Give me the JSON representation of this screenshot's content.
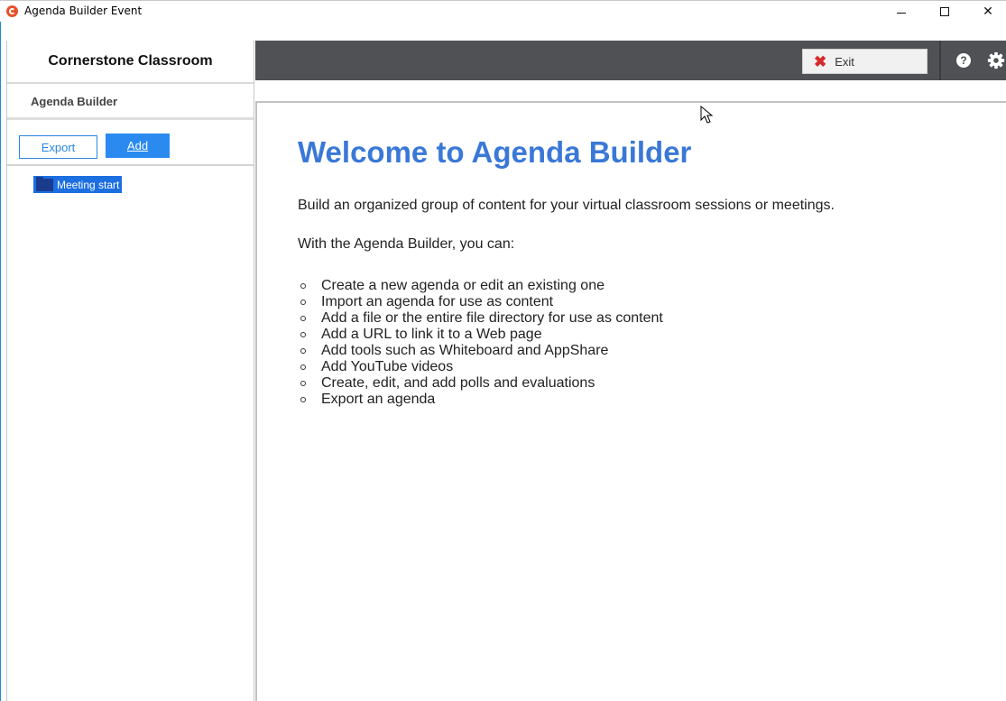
{
  "window": {
    "title": "Agenda Builder Event",
    "minimize": "–",
    "maximize": "□",
    "close": "✕"
  },
  "sidebar": {
    "brand": "Cornerstone Classroom",
    "section_title": "Agenda Builder",
    "export_label": "Export",
    "add_label": "Add",
    "tree": [
      {
        "label": "Meeting start",
        "icon": "folder-icon",
        "selected": true
      }
    ]
  },
  "toolbar": {
    "exit_label": "Exit",
    "help_icon": "help-icon",
    "settings_icon": "gear-icon"
  },
  "content": {
    "heading": "Welcome to Agenda Builder",
    "intro": "Build an organized group of content for your virtual classroom sessions or meetings.",
    "lead": "With the Agenda Builder, you can:",
    "features": [
      "Create a new agenda or edit an existing one",
      "Import an agenda for use as content",
      "Add a file or the entire file directory for use as content",
      "Add a URL to link it to a Web page",
      "Add tools such as Whiteboard and AppShare",
      "Add YouTube videos",
      "Create, edit, and add polls and evaluations",
      "Export an agenda"
    ]
  },
  "colors": {
    "accent": "#2a8af0",
    "heading": "#3a78d8",
    "topbar": "#4f5154",
    "exit_icon": "#d42b2b",
    "selection": "#1c6fe0"
  }
}
